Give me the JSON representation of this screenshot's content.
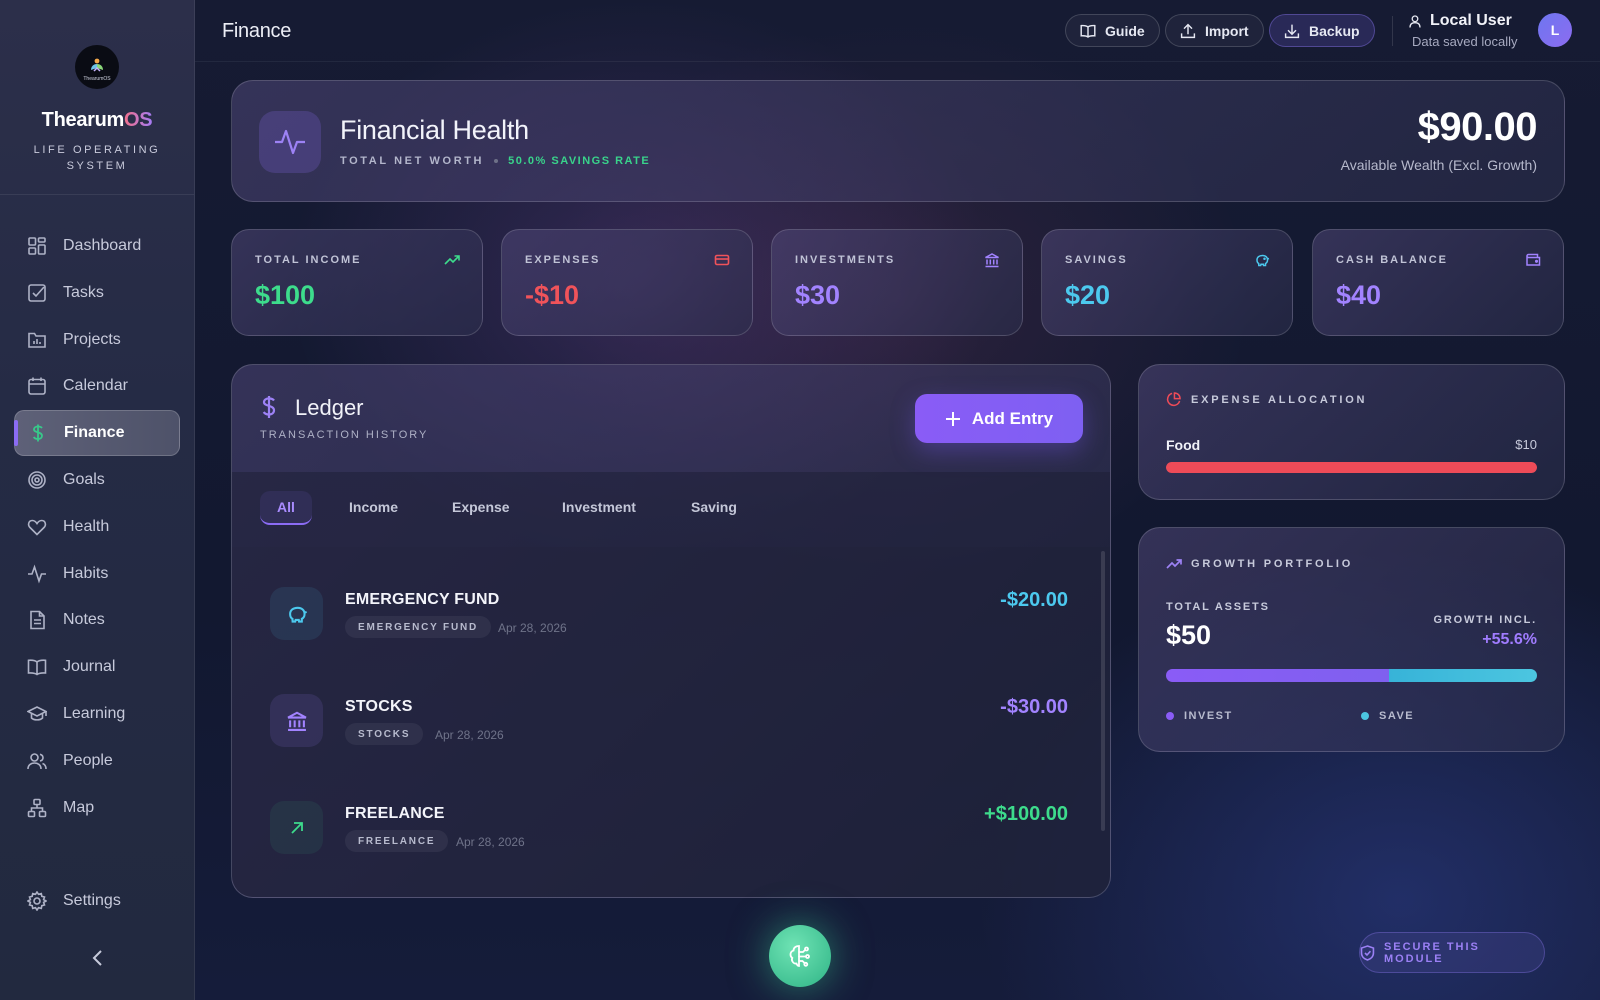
{
  "brand": {
    "name_main": "Thearum",
    "name_accent": "OS",
    "logo_text": "ThearumOS",
    "subtitle": "LIFE OPERATING SYSTEM"
  },
  "nav": [
    {
      "label": "Dashboard",
      "icon": "dashboard-icon"
    },
    {
      "label": "Tasks",
      "icon": "tasks-icon"
    },
    {
      "label": "Projects",
      "icon": "projects-icon"
    },
    {
      "label": "Calendar",
      "icon": "calendar-icon"
    },
    {
      "label": "Finance",
      "icon": "dollar-icon",
      "active": true
    },
    {
      "label": "Goals",
      "icon": "target-icon"
    },
    {
      "label": "Health",
      "icon": "heart-icon"
    },
    {
      "label": "Habits",
      "icon": "activity-icon"
    },
    {
      "label": "Notes",
      "icon": "notes-icon"
    },
    {
      "label": "Journal",
      "icon": "book-icon"
    },
    {
      "label": "Learning",
      "icon": "graduation-cap-icon"
    },
    {
      "label": "People",
      "icon": "people-icon"
    },
    {
      "label": "Map",
      "icon": "sitemap-icon"
    }
  ],
  "settings_label": "Settings",
  "topbar": {
    "title": "Finance",
    "guide": "Guide",
    "import": "Import",
    "backup": "Backup",
    "user_name": "Local User",
    "user_status": "Data saved locally",
    "avatar_initial": "L"
  },
  "hero": {
    "title": "Financial Health",
    "subtitle": "TOTAL NET WORTH",
    "savings_rate": "50.0% SAVINGS RATE",
    "amount": "$90.00",
    "note": "Available Wealth (Excl. Growth)"
  },
  "stats": [
    {
      "label": "TOTAL INCOME",
      "value": "$100",
      "icon": "trending-up-icon",
      "color": "#3ddc8c"
    },
    {
      "label": "EXPENSES",
      "value": "-$10",
      "icon": "credit-card-icon",
      "color": "#f0535a"
    },
    {
      "label": "INVESTMENTS",
      "value": "$30",
      "icon": "bank-icon",
      "color": "#a283ff"
    },
    {
      "label": "SAVINGS",
      "value": "$20",
      "icon": "piggy-bank-icon",
      "color": "#4cc9ee"
    },
    {
      "label": "CASH BALANCE",
      "value": "$40",
      "icon": "wallet-icon",
      "color": "#a283ff"
    }
  ],
  "ledger": {
    "title": "Ledger",
    "subtitle": "TRANSACTION HISTORY",
    "add_label": "Add Entry",
    "tabs": [
      "All",
      "Income",
      "Expense",
      "Investment",
      "Saving"
    ],
    "active_tab": "All",
    "entries": [
      {
        "name": "EMERGENCY FUND",
        "tag": "EMERGENCY FUND",
        "date": "Apr 28, 2026",
        "amount": "-$20.00",
        "color": "#4cc9ee",
        "icon": "piggy-bank-icon"
      },
      {
        "name": "STOCKS",
        "tag": "STOCKS",
        "date": "Apr 28, 2026",
        "amount": "-$30.00",
        "color": "#a283ff",
        "icon": "bank-icon"
      },
      {
        "name": "FREELANCE",
        "tag": "FREELANCE",
        "date": "Apr 28, 2026",
        "amount": "+$100.00",
        "color": "#3ddc8c",
        "icon": "arrow-up-right-icon"
      }
    ]
  },
  "allocation": {
    "title": "EXPENSE ALLOCATION",
    "items": [
      {
        "name": "Food",
        "value": "$10",
        "fraction": 1.0,
        "color": "#ee4b58"
      }
    ]
  },
  "growth": {
    "title": "GROWTH PORTFOLIO",
    "total_label": "TOTAL ASSETS",
    "total": "$50",
    "incl_label": "GROWTH INCL.",
    "incl_value": "+55.6%",
    "invest_fraction": 0.6,
    "legend_invest": "INVEST",
    "legend_save": "SAVE"
  },
  "secure_label": "SECURE THIS MODULE"
}
